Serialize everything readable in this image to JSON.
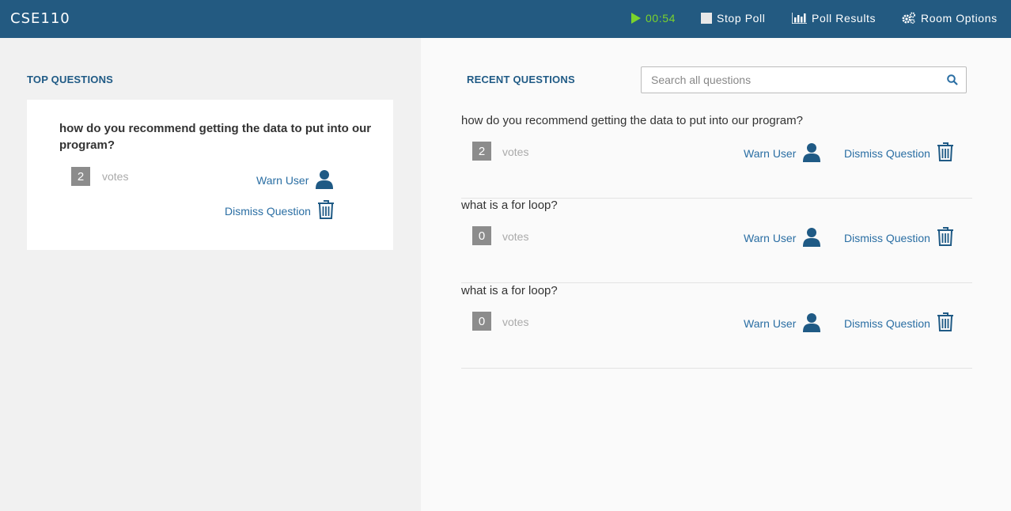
{
  "header": {
    "title": "CSE110",
    "timer": "00:54",
    "stop_poll": "Stop Poll",
    "poll_results": "Poll Results",
    "room_options": "Room Options"
  },
  "top_questions": {
    "heading": "TOP QUESTIONS",
    "items": [
      {
        "text": "how do you recommend getting the data to put into our program?",
        "votes": "2",
        "votes_label": "votes",
        "warn_label": "Warn User",
        "dismiss_label": "Dismiss Question"
      }
    ]
  },
  "recent_questions": {
    "heading": "RECENT QUESTIONS",
    "search_placeholder": "Search all questions",
    "items": [
      {
        "text": "how do you recommend getting the data to put into our program?",
        "votes": "2",
        "votes_label": "votes",
        "warn_label": "Warn User",
        "dismiss_label": "Dismiss Question"
      },
      {
        "text": "what is a for loop?",
        "votes": "0",
        "votes_label": "votes",
        "warn_label": "Warn User",
        "dismiss_label": "Dismiss Question"
      },
      {
        "text": "what is a for loop?",
        "votes": "0",
        "votes_label": "votes",
        "warn_label": "Warn User",
        "dismiss_label": "Dismiss Question"
      }
    ]
  },
  "colors": {
    "header_bg": "#235a81",
    "timer": "#7bd32c",
    "accent": "#1f5a85",
    "link": "#2a6ea3"
  }
}
